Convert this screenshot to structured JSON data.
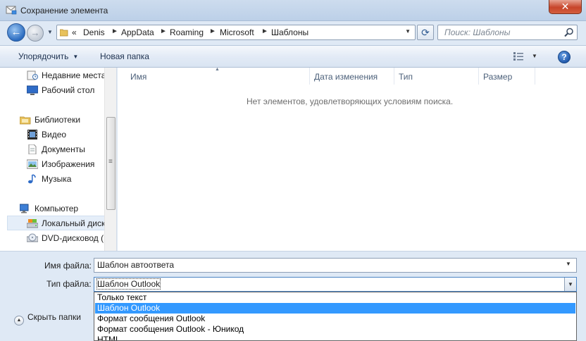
{
  "window": {
    "title": "Сохранение элемента",
    "close_glyph": "✕"
  },
  "navigation": {
    "back_glyph": "←",
    "forward_glyph": "→",
    "breadcrumb": [
      "Denis",
      "AppData",
      "Roaming",
      "Microsoft",
      "Шаблоны"
    ],
    "overflow_glyph": "«",
    "separator_glyph": "►",
    "refresh_glyph": "⟳",
    "search_placeholder": "Поиск: Шаблоны"
  },
  "toolbar": {
    "organize_label": "Упорядочить",
    "new_folder_label": "Новая папка",
    "help_glyph": "?"
  },
  "sidebar": {
    "items": [
      {
        "label": "Недавние места",
        "icon": "recent-places-icon"
      },
      {
        "label": "Рабочий стол",
        "icon": "desktop-icon"
      },
      {
        "label": "Библиотеки",
        "icon": "libraries-icon"
      },
      {
        "label": "Видео",
        "icon": "video-icon"
      },
      {
        "label": "Документы",
        "icon": "documents-icon"
      },
      {
        "label": "Изображения",
        "icon": "pictures-icon"
      },
      {
        "label": "Музыка",
        "icon": "music-icon"
      },
      {
        "label": "Компьютер",
        "icon": "computer-icon"
      },
      {
        "label": "Локальный диск",
        "icon": "local-disk-icon"
      },
      {
        "label": "DVD-дисковод (I",
        "icon": "dvd-drive-icon"
      }
    ],
    "selected": "Локальный диск"
  },
  "file_list": {
    "columns": [
      "Имя",
      "Дата изменения",
      "Тип",
      "Размер"
    ],
    "empty_message": "Нет элементов, удовлетворяющих условиям поиска."
  },
  "form": {
    "filename_label": "Имя файла:",
    "filename_value": "Шаблон автоответа",
    "filetype_label": "Тип файла:",
    "filetype_value": "Шаблон Outlook",
    "filetype_options": [
      "Только текст",
      "Шаблон Outlook",
      "Формат сообщения Outlook",
      "Формат сообщения Outlook - Юникод",
      "HTML"
    ],
    "filetype_selected": "Шаблон Outlook",
    "hide_folders_label": "Скрыть папки"
  },
  "colors": {
    "selection": "#3399ff",
    "titlebar": "#c6d7ec",
    "close": "#c7452a"
  }
}
